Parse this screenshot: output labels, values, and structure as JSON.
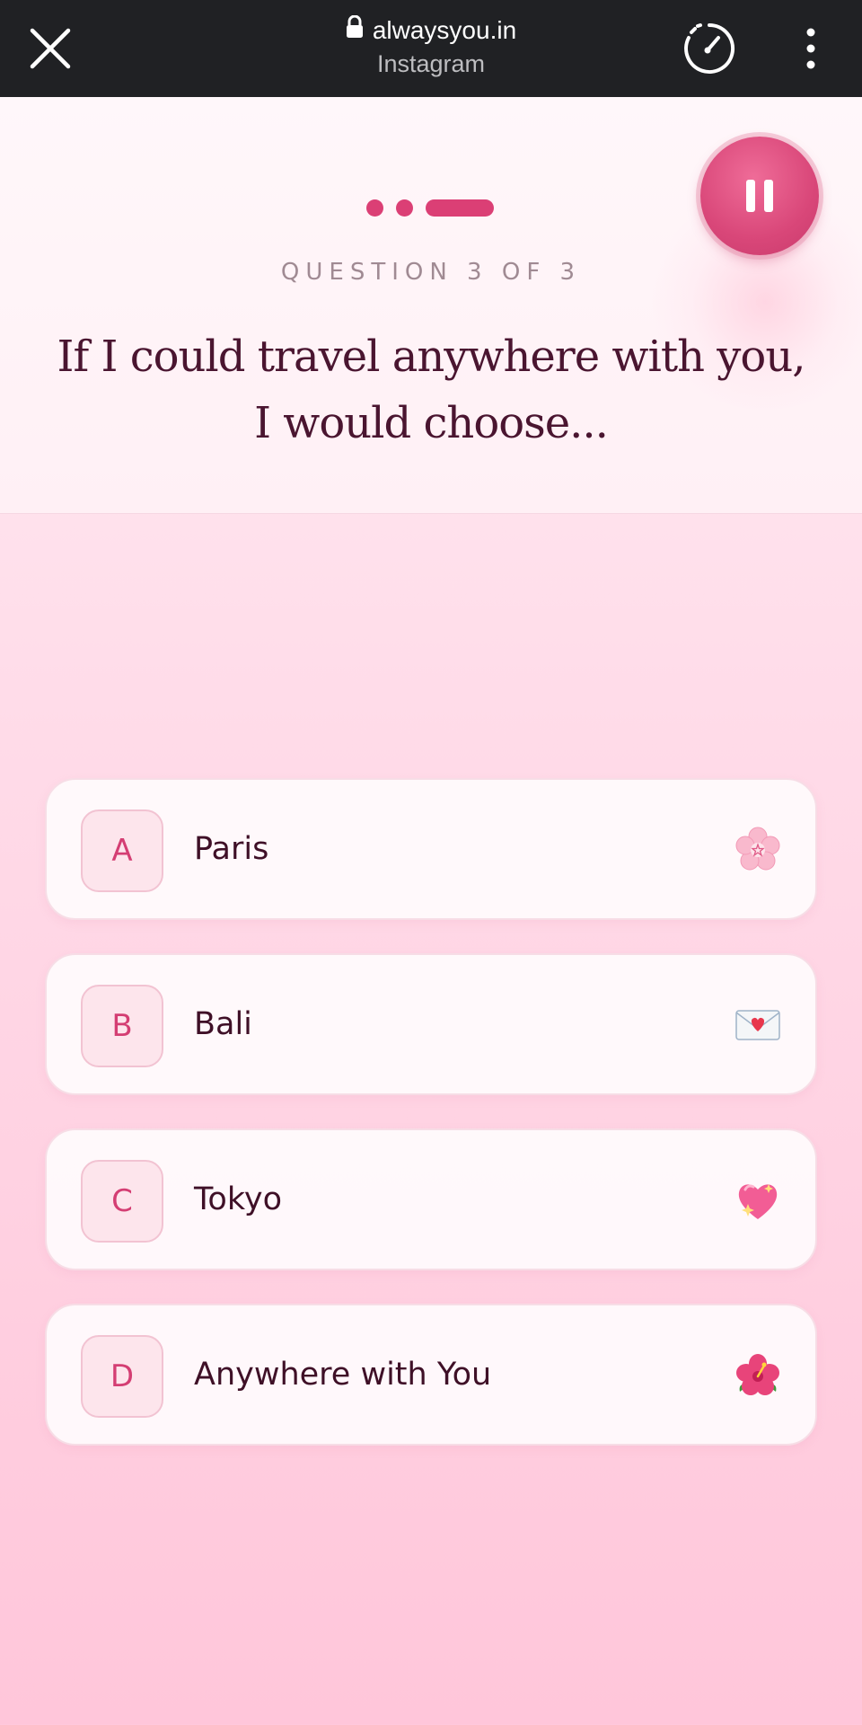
{
  "browser": {
    "url": "alwaysyou.in",
    "app_name": "Instagram"
  },
  "quiz": {
    "progress": {
      "current": 3,
      "total": 3
    },
    "question_count": "QUESTION 3 OF 3",
    "question_line1": "If I could travel anywhere with you,",
    "question_line2": "I would choose..."
  },
  "options": [
    {
      "letter": "A",
      "label": "Paris",
      "icon": "cherry-blossom-icon"
    },
    {
      "letter": "B",
      "label": "Bali",
      "icon": "love-letter-icon"
    },
    {
      "letter": "C",
      "label": "Tokyo",
      "icon": "sparkling-heart-icon"
    },
    {
      "letter": "D",
      "label": "Anywhere with You",
      "icon": "hibiscus-icon"
    }
  ],
  "colors": {
    "accent": "#db3f75",
    "text_dark": "#4a1530",
    "muted": "#a08a93",
    "topbar": "#202124"
  }
}
